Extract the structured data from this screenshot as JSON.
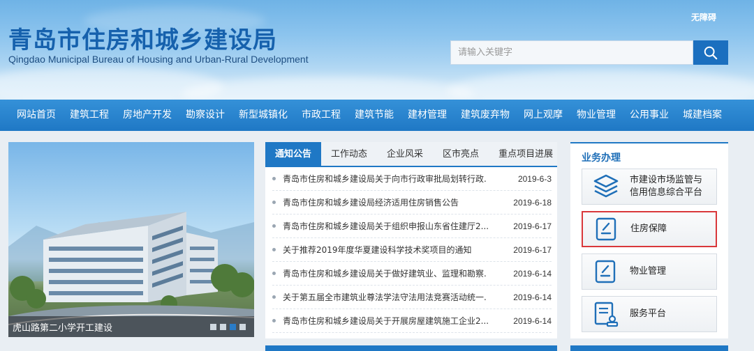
{
  "header": {
    "accessibility_label": "无障碍",
    "title": "青岛市住房和城乡建设局",
    "subtitle": "Qingdao Municipal Bureau of Housing and Urban-Rural Development",
    "search_placeholder": "请输入关键字",
    "search_icon": "search-icon"
  },
  "nav": {
    "items": [
      "网站首页",
      "建筑工程",
      "房地产开发",
      "勘察设计",
      "新型城镇化",
      "市政工程",
      "建筑节能",
      "建材管理",
      "建筑废弃物",
      "网上观摩",
      "物业管理",
      "公用事业",
      "城建档案"
    ]
  },
  "slideshow": {
    "caption": "虎山路第二小学开工建设",
    "dot_count": 4,
    "active_dot": 3
  },
  "news": {
    "tabs": [
      "通知公告",
      "工作动态",
      "企业风采",
      "区市亮点",
      "重点项目进展"
    ],
    "active_tab": 0,
    "items": [
      {
        "title": "青岛市住房和城乡建设局关于向市行政审批局划转行政.",
        "date": "2019-6-3"
      },
      {
        "title": "青岛市住房和城乡建设局经济适用住房销售公告",
        "date": "2019-6-18"
      },
      {
        "title": "青岛市住房和城乡建设局关于组织申报山东省住建厅2...",
        "date": "2019-6-17"
      },
      {
        "title": "关于推荐2019年度华夏建设科学技术奖项目的通知",
        "date": "2019-6-17"
      },
      {
        "title": "青岛市住房和城乡建设局关于做好建筑业、监理和勘察.",
        "date": "2019-6-14"
      },
      {
        "title": "关于第五届全市建筑业尊法学法守法用法竞赛活动统一.",
        "date": "2019-6-14"
      },
      {
        "title": "青岛市住房和城乡建设局关于开展房屋建筑施工企业2...",
        "date": "2019-6-14"
      }
    ]
  },
  "business": {
    "heading": "业务办理",
    "buttons": [
      {
        "line1": "市建设市场监管与",
        "line2": "信用信息综合平台",
        "icon": "layers-icon",
        "highlighted": false
      },
      {
        "line1": "住房保障",
        "line2": "",
        "icon": "edit-document-icon",
        "highlighted": true
      },
      {
        "line1": "物业管理",
        "line2": "",
        "icon": "edit-document-icon",
        "highlighted": false
      },
      {
        "line1": "服务平台",
        "line2": "",
        "icon": "document-stamp-icon",
        "highlighted": false
      }
    ]
  },
  "colors": {
    "primary": "#1f78c5",
    "title_blue": "#1661ad",
    "highlight_border": "#d9373a"
  }
}
